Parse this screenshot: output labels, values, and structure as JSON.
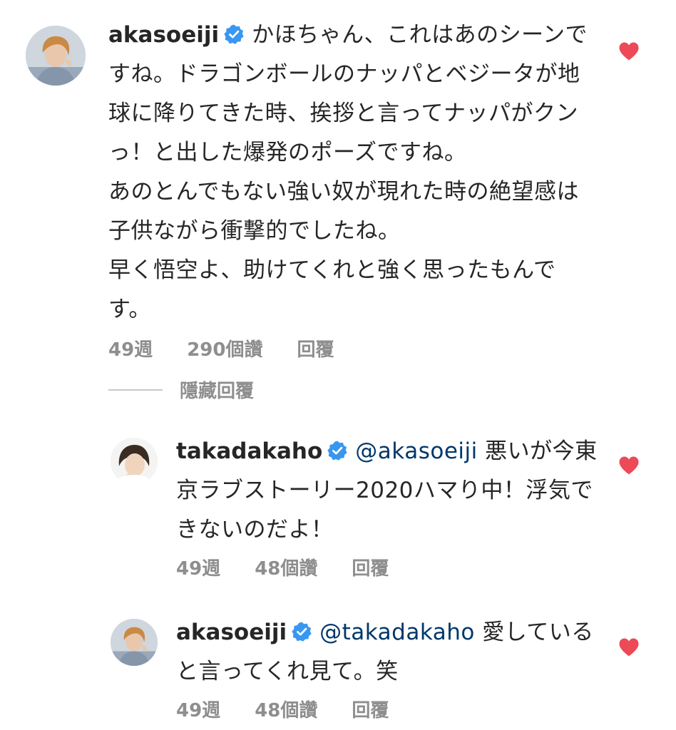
{
  "comments": [
    {
      "username": "akasoeiji",
      "verified": true,
      "mention": "",
      "text": "かほちゃん、これはあのシーンですね。ドラゴンボールのナッパとベジータが地球に降りてきた時、挨拶と言ってナッパがクンっ！と出した爆発のポーズですね。\nあのとんでもない強い奴が現れた時の絶望感は子供ながら衝撃的でしたね。\n早く悟空よ、助けてくれと強く思ったもんです。",
      "time": "49週",
      "likes": "290個讚",
      "reply_label": "回覆",
      "liked": true
    }
  ],
  "replies_toggle": "隱藏回覆",
  "replies": [
    {
      "username": "takadakaho",
      "verified": true,
      "mention": "@akasoeiji",
      "text": "悪いが今東京ラブストーリー2020ハマり中！浮気できないのだよ！",
      "time": "49週",
      "likes": "48個讚",
      "reply_label": "回覆",
      "liked": true
    },
    {
      "username": "akasoeiji",
      "verified": true,
      "mention": "@takadakaho",
      "text": "愛していると言ってくれ見て。笑",
      "time": "49週",
      "likes": "48個讚",
      "reply_label": "回覆",
      "liked": true
    }
  ],
  "colors": {
    "text": "#262626",
    "meta": "#8e8e8e",
    "mention": "#00376b",
    "verified": "#3897f0",
    "heart": "#ed4956"
  },
  "icons": {
    "verified": "verified-badge-icon",
    "like": "heart-filled-icon"
  }
}
